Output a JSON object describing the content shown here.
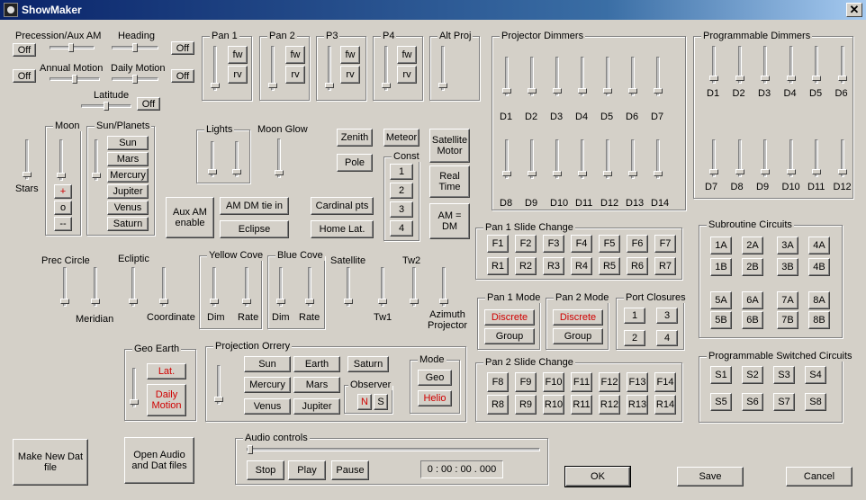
{
  "window": {
    "title": "ShowMaker",
    "close": "✕"
  },
  "motion": {
    "precession": "Precession/Aux AM",
    "heading": "Heading",
    "annual": "Annual Motion",
    "daily": "Daily Motion",
    "latitude": "Latitude",
    "off": "Off"
  },
  "pan_groups": [
    {
      "label": "Pan 1",
      "fw": "fw",
      "rv": "rv"
    },
    {
      "label": "Pan 2",
      "fw": "fw",
      "rv": "rv"
    },
    {
      "label": "P3",
      "fw": "fw",
      "rv": "rv"
    },
    {
      "label": "P4",
      "fw": "fw",
      "rv": "rv"
    }
  ],
  "alt_proj": "Alt Proj",
  "projector_dimmers": {
    "label": "Projector Dimmers",
    "row1": [
      "D1",
      "D2",
      "D3",
      "D4",
      "D5",
      "D6",
      "D7"
    ],
    "row2": [
      "D8",
      "D9",
      "D10",
      "D11",
      "D12",
      "D13",
      "D14"
    ]
  },
  "programmable_dimmers": {
    "label": "Programmable Dimmers",
    "row1": [
      "D1",
      "D2",
      "D3",
      "D4",
      "D5",
      "D6"
    ],
    "row2": [
      "D7",
      "D8",
      "D9",
      "D10",
      "D11",
      "D12"
    ]
  },
  "stars": "Stars",
  "moon": {
    "label": "Moon",
    "plus": "+",
    "zero": "o",
    "minus": "--"
  },
  "sun_planets": {
    "label": "Sun/Planets",
    "items": [
      "Sun",
      "Mars",
      "Mercury",
      "Jupiter",
      "Venus",
      "Saturn"
    ]
  },
  "lights": "Lights",
  "moon_glow": "Moon Glow",
  "zenith": "Zenith",
  "meteor": "Meteor",
  "pole": "Pole",
  "const": {
    "label": "Const",
    "items": [
      "1",
      "2",
      "3",
      "4"
    ]
  },
  "satellite_motor": "Satellite Motor",
  "real_time": "Real Time",
  "am_dm": "AM = DM",
  "aux_am_enable": "Aux AM enable",
  "am_dm_tie": "AM DM tie in",
  "eclipse": "Eclipse",
  "cardinal_pts": "Cardinal pts",
  "home_lat": "Home Lat.",
  "pan1_slide": {
    "label": "Pan 1 Slide Change",
    "f": [
      "F1",
      "F2",
      "F3",
      "F4",
      "F5",
      "F6",
      "F7"
    ],
    "r": [
      "R1",
      "R2",
      "R3",
      "R4",
      "R5",
      "R6",
      "R7"
    ]
  },
  "pan2_slide": {
    "label": "Pan 2 Slide Change",
    "f": [
      "F8",
      "F9",
      "F10",
      "F11",
      "F12",
      "F13",
      "F14"
    ],
    "r": [
      "R8",
      "R9",
      "R10",
      "R11",
      "R12",
      "R13",
      "R14"
    ]
  },
  "subroutine": {
    "label": "Subroutine Circuits",
    "items": [
      "1A",
      "2A",
      "3A",
      "4A",
      "1B",
      "2B",
      "3B",
      "4B",
      "5A",
      "6A",
      "7A",
      "8A",
      "5B",
      "6B",
      "7B",
      "8B"
    ]
  },
  "switched": {
    "label": "Programmable Switched Circuits",
    "items": [
      "S1",
      "S2",
      "S3",
      "S4",
      "S5",
      "S6",
      "S7",
      "S8"
    ]
  },
  "pan1_mode": {
    "label": "Pan 1 Mode",
    "discrete": "Discrete",
    "group": "Group"
  },
  "pan2_mode": {
    "label": "Pan 2 Mode",
    "discrete": "Discrete",
    "group": "Group"
  },
  "port_closures": {
    "label": "Port Closures",
    "items": [
      "1",
      "3",
      "2",
      "4"
    ]
  },
  "sliders_row": {
    "prec_circle": "Prec Circle",
    "ecliptic": "Ecliptic",
    "meridian": "Meridian",
    "coordinate": "Coordinate",
    "satellite": "Satellite",
    "tw2": "Tw2",
    "tw1": "Tw1",
    "azimuth": "Azimuth Projector"
  },
  "yellow_cove": {
    "label": "Yellow Cove",
    "dim": "Dim",
    "rate": "Rate"
  },
  "blue_cove": {
    "label": "Blue Cove",
    "dim": "Dim",
    "rate": "Rate"
  },
  "geo_earth": {
    "label": "Geo Earth",
    "lat": "Lat.",
    "daily": "Daily Motion"
  },
  "orrery": {
    "label": "Projection Orrery",
    "planets": [
      "Sun",
      "Earth",
      "Saturn",
      "Mercury",
      "Mars",
      "Venus",
      "Jupiter"
    ],
    "observer": "Observer",
    "n": "N",
    "s": "S"
  },
  "mode": {
    "label": "Mode",
    "geo": "Geo",
    "helio": "Helio"
  },
  "audio": {
    "label": "Audio controls",
    "stop": "Stop",
    "play": "Play",
    "pause": "Pause",
    "time": "0 : 00 : 00 . 000"
  },
  "bottom": {
    "make_new": "Make New Dat file",
    "open_audio": "Open Audio and Dat files",
    "ok": "OK",
    "save": "Save",
    "cancel": "Cancel"
  },
  "colors": {
    "titlebar": "#0a246a",
    "face": "#d4d0c8",
    "active_text": "#d00000"
  }
}
